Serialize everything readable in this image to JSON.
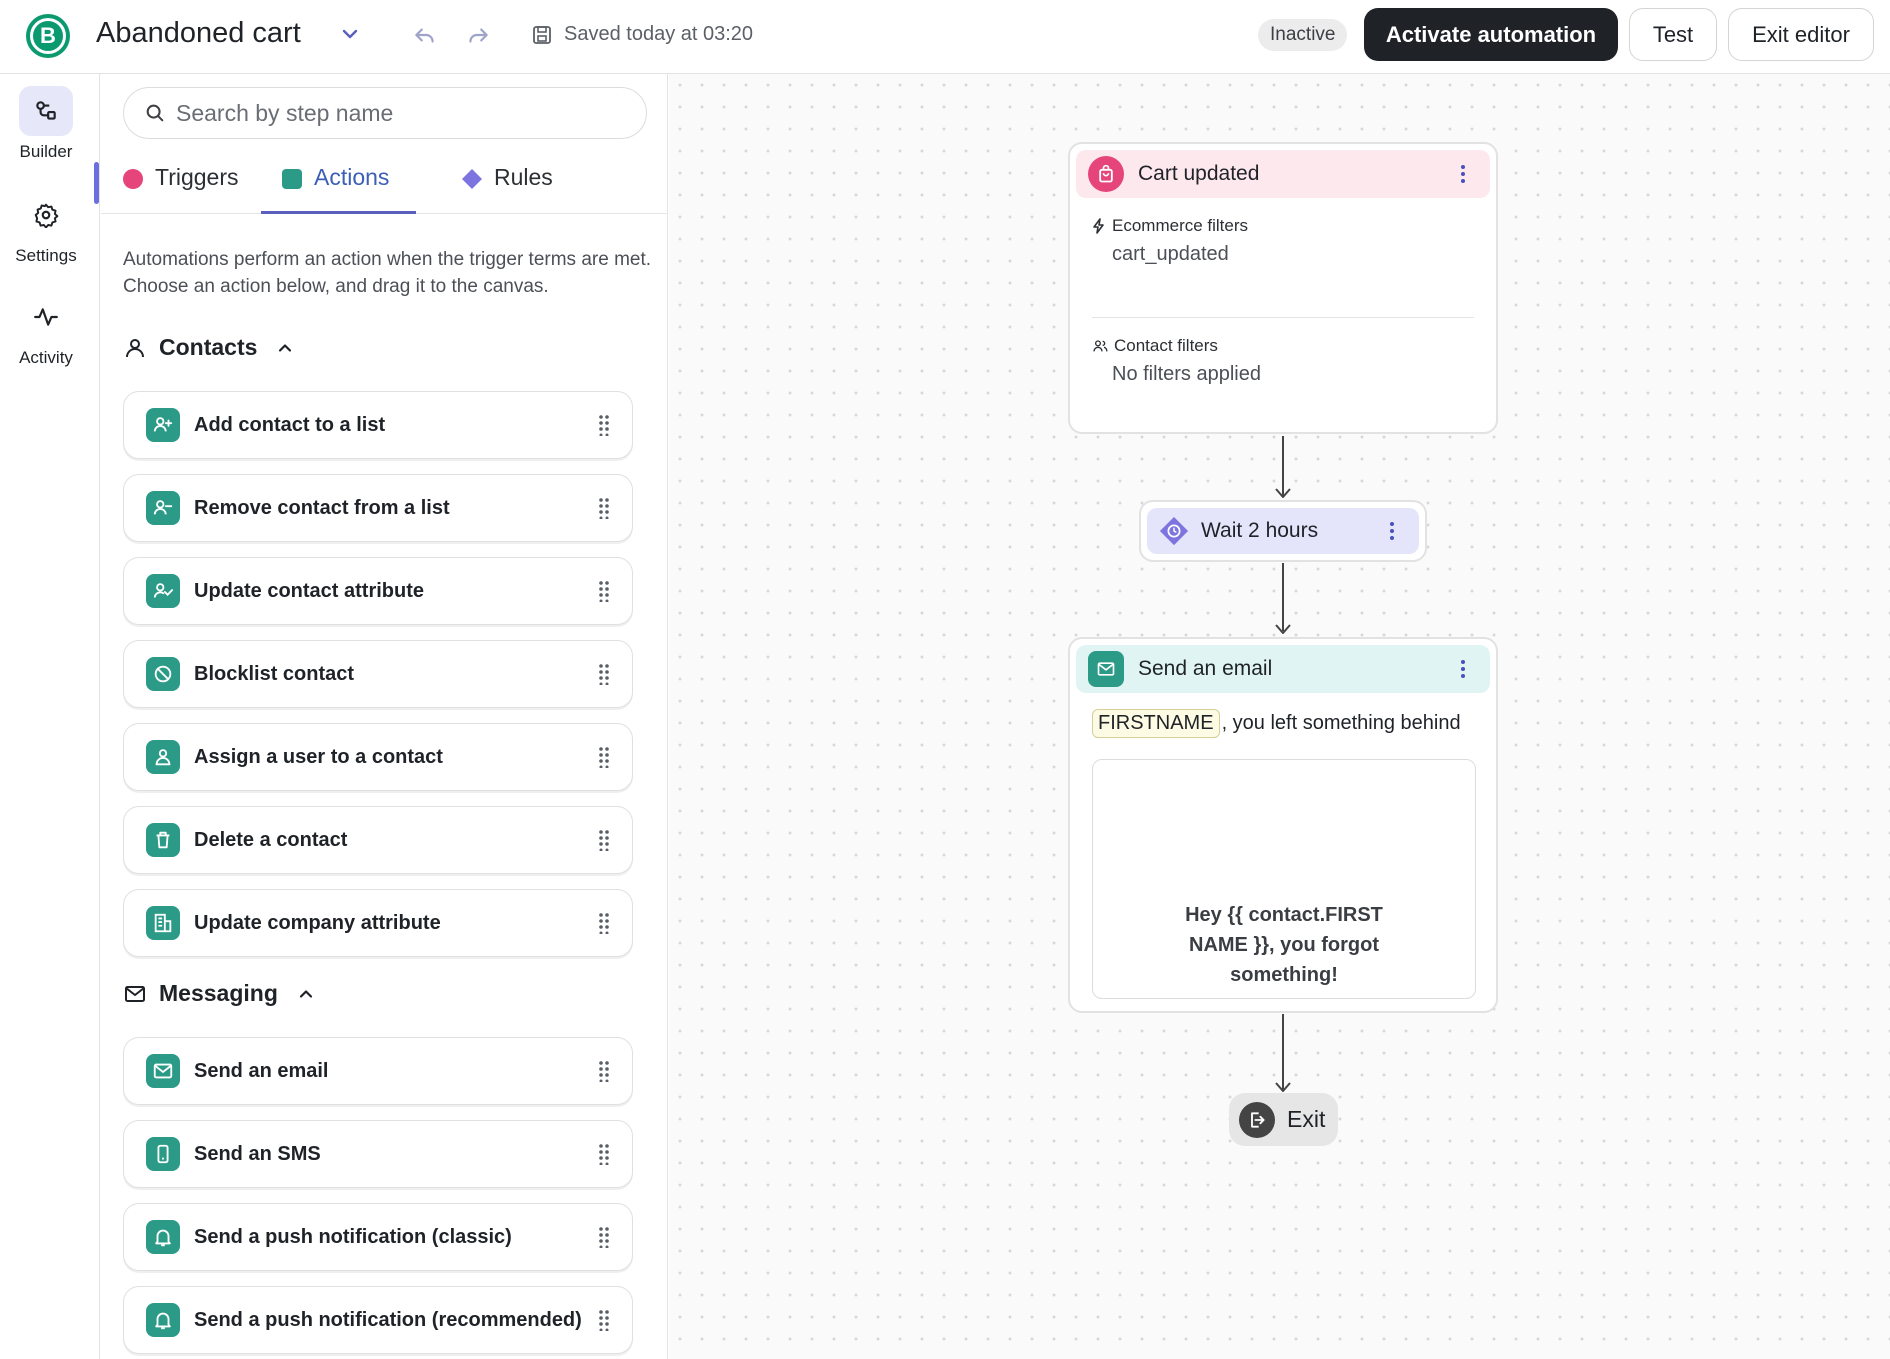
{
  "header": {
    "logo_letter": "B",
    "title": "Abandoned cart",
    "saved_text": "Saved today at 03:20",
    "status": "Inactive",
    "activate_label": "Activate automation",
    "test_label": "Test",
    "exit_label": "Exit editor"
  },
  "rail": {
    "items": [
      {
        "label": "Builder",
        "icon": "builder-icon",
        "active": true
      },
      {
        "label": "Settings",
        "icon": "gear-icon",
        "active": false
      },
      {
        "label": "Activity",
        "icon": "activity-icon",
        "active": false
      }
    ]
  },
  "panel": {
    "search_placeholder": "Search by step name",
    "tabs": [
      {
        "label": "Triggers",
        "color": "#e5457a",
        "active": false
      },
      {
        "label": "Actions",
        "color": "#2b9b87",
        "active": true
      },
      {
        "label": "Rules",
        "color": "#7d74e0",
        "active": false
      }
    ],
    "intro": "Automations perform an action when the trigger terms are met. Choose an action below, and drag it to the canvas.",
    "contacts": {
      "title": "Contacts",
      "items": [
        "Add contact to a list",
        "Remove contact from a list",
        "Update contact attribute",
        "Blocklist contact",
        "Assign a user to a contact",
        "Delete a contact",
        "Update company attribute"
      ]
    },
    "messaging": {
      "title": "Messaging",
      "items": [
        "Send an email",
        "Send an SMS",
        "Send a push notification (classic)",
        "Send a push notification (recommended)"
      ]
    }
  },
  "canvas": {
    "trigger": {
      "title": "Cart updated",
      "ecommerce_label": "Ecommerce filters",
      "ecommerce_value": "cart_updated",
      "contact_label": "Contact filters",
      "contact_value": "No filters applied",
      "color": "#fde8ee"
    },
    "wait": {
      "title": "Wait 2 hours",
      "color": "#e4e4fa"
    },
    "email": {
      "title": "Send an email",
      "tag": "FIRSTNAME",
      "subject_rest": ", you left something behind",
      "preview": "Hey {{ contact.FIRSTNAME }}, you forgot something!",
      "color": "#dff4f3"
    },
    "exit_label": "Exit"
  },
  "colors": {
    "brand": "#0b996e",
    "accent": "#5a5fbd",
    "primary_button": "#1f2328",
    "action_icon": "#2b9b87"
  }
}
